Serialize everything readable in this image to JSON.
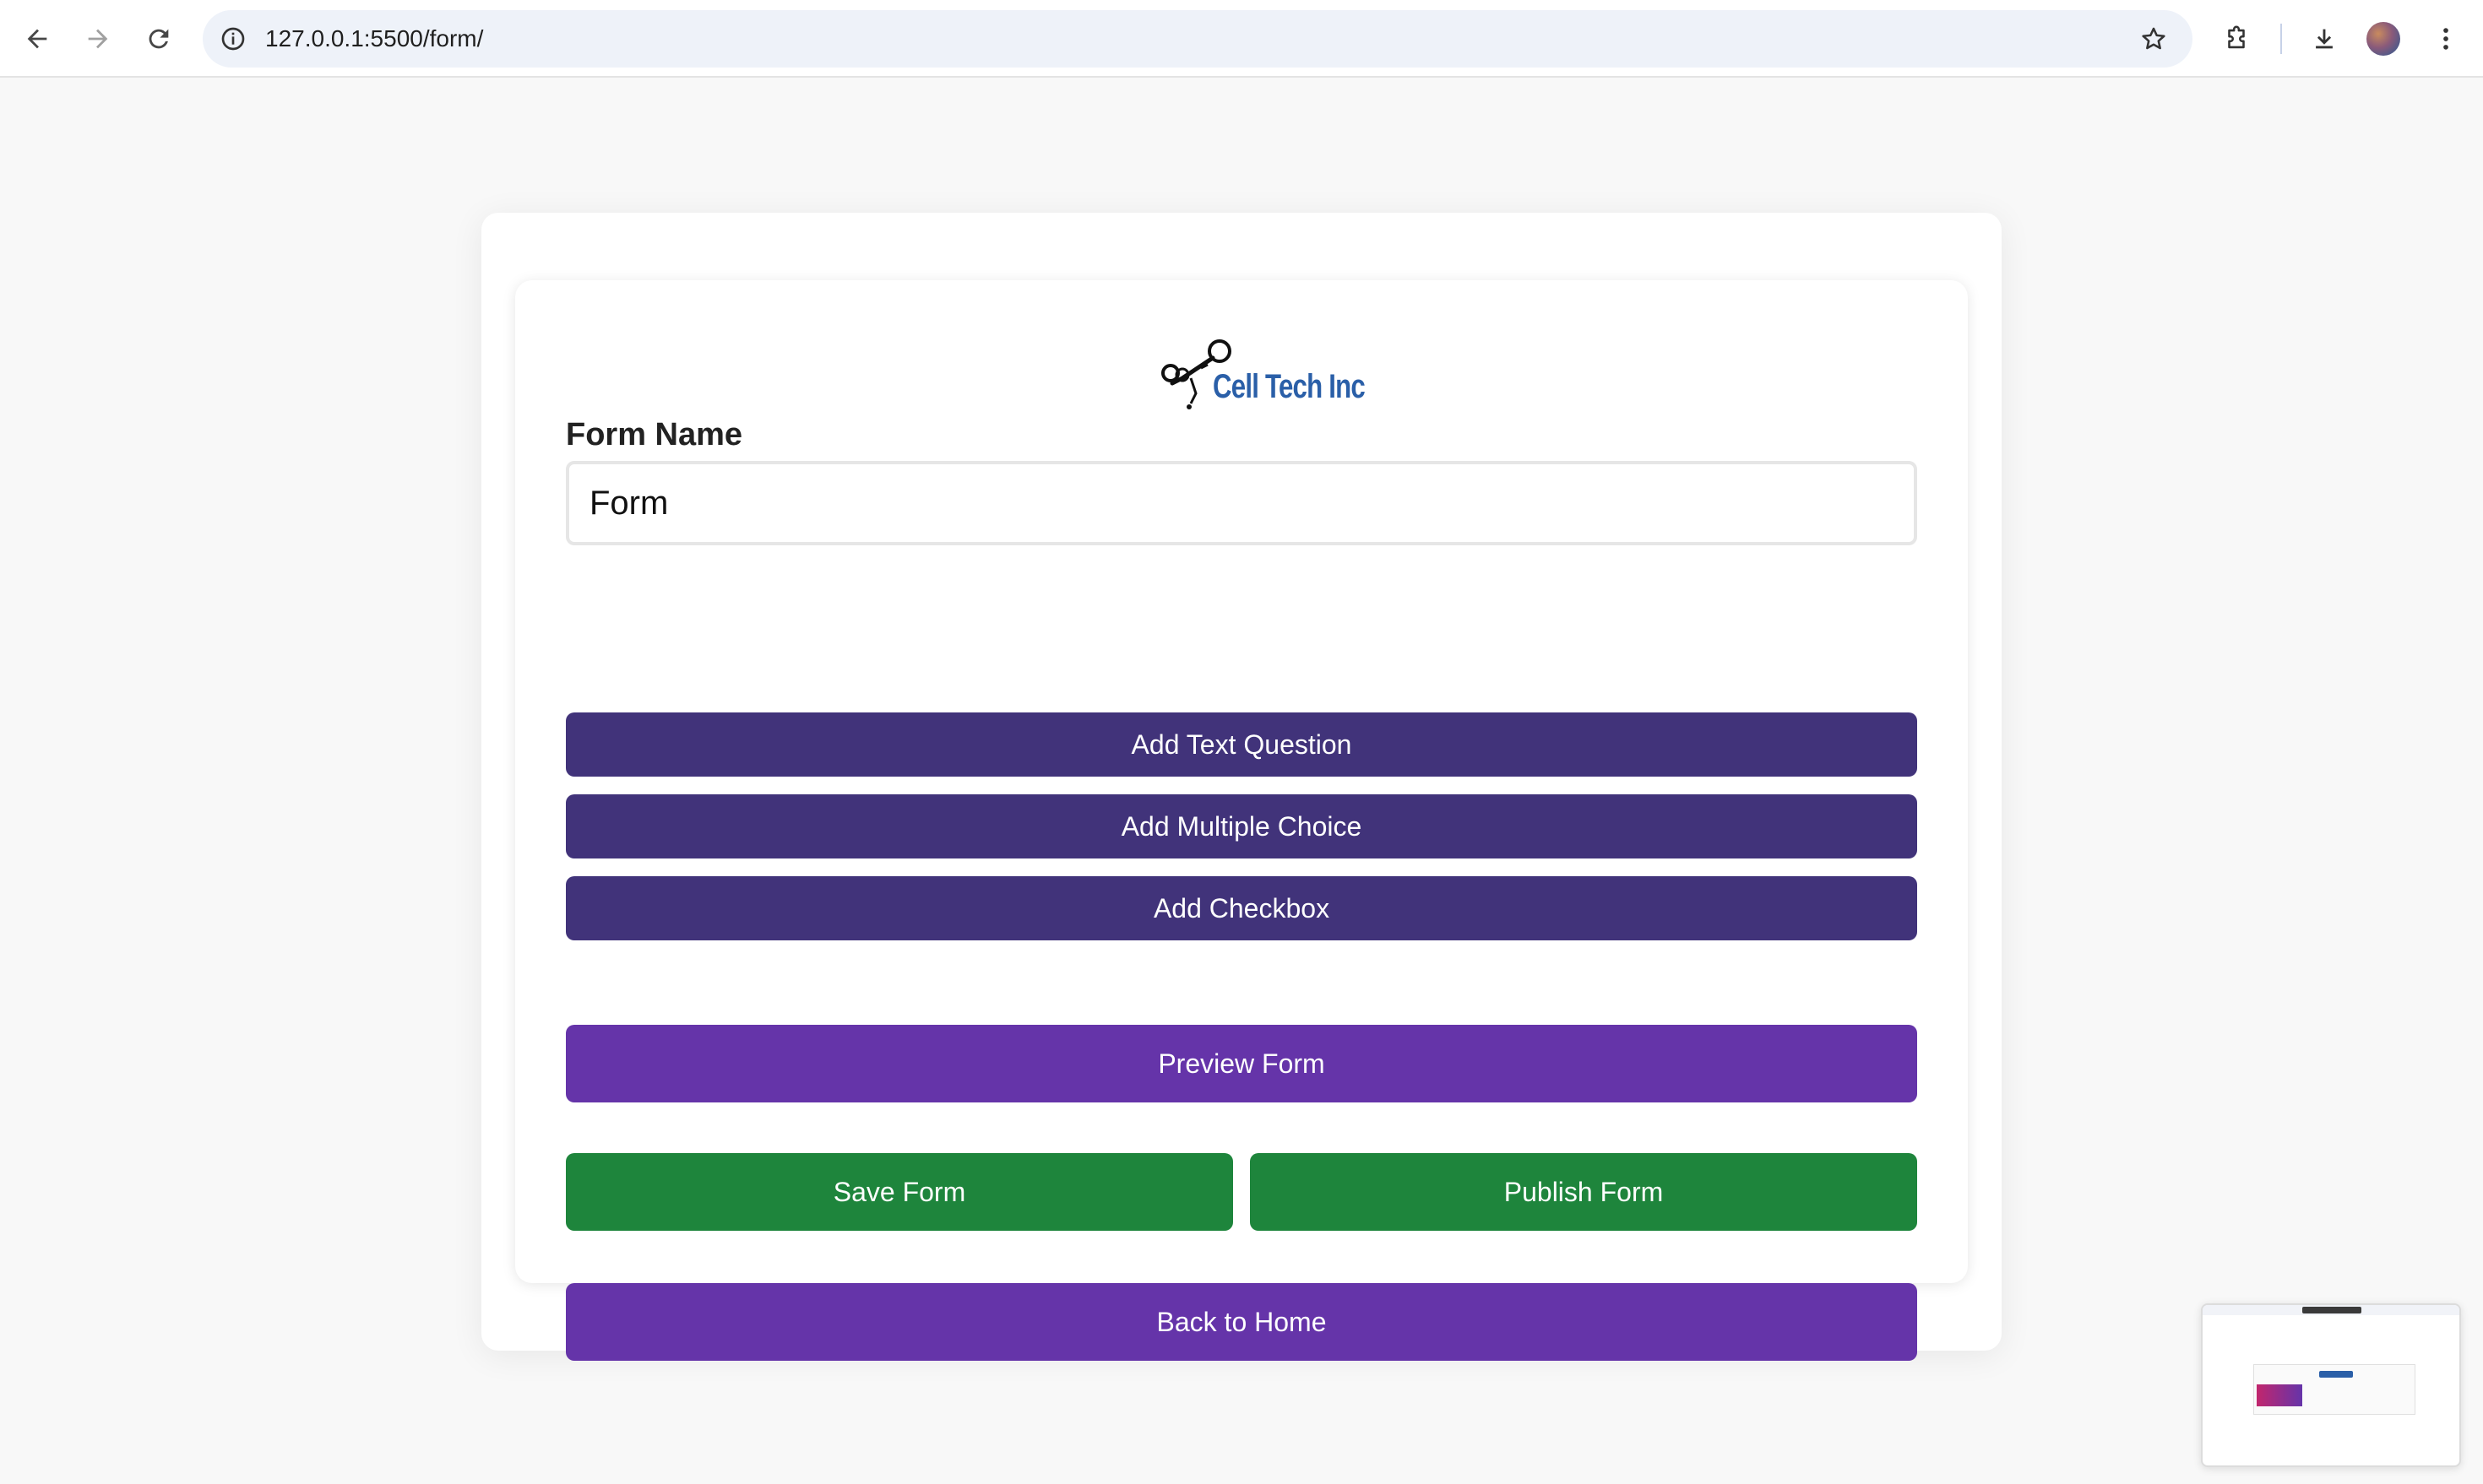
{
  "browser": {
    "url": "127.0.0.1:5500/form/",
    "icons": {
      "back": "arrow-left-icon",
      "forward": "arrow-right-icon",
      "reload": "reload-icon",
      "site_info": "info-icon",
      "bookmark": "star-icon",
      "extensions": "puzzle-icon",
      "downloads": "download-icon",
      "menu": "kebab-menu-icon"
    }
  },
  "logo": {
    "text": "Cell Tech Inc"
  },
  "form": {
    "name_label": "Form Name",
    "name_value": "Form"
  },
  "buttons": {
    "add_text_question": "Add Text Question",
    "add_multiple_choice": "Add Multiple Choice",
    "add_checkbox": "Add Checkbox",
    "preview_form": "Preview Form",
    "save_form": "Save Form",
    "publish_form": "Publish Form",
    "back_to_home": "Back to Home"
  },
  "colors": {
    "add_buttons": "#41337a",
    "primary_purple": "#6534a9",
    "green": "#1e853c",
    "logo_blue": "#2a5fa8"
  }
}
